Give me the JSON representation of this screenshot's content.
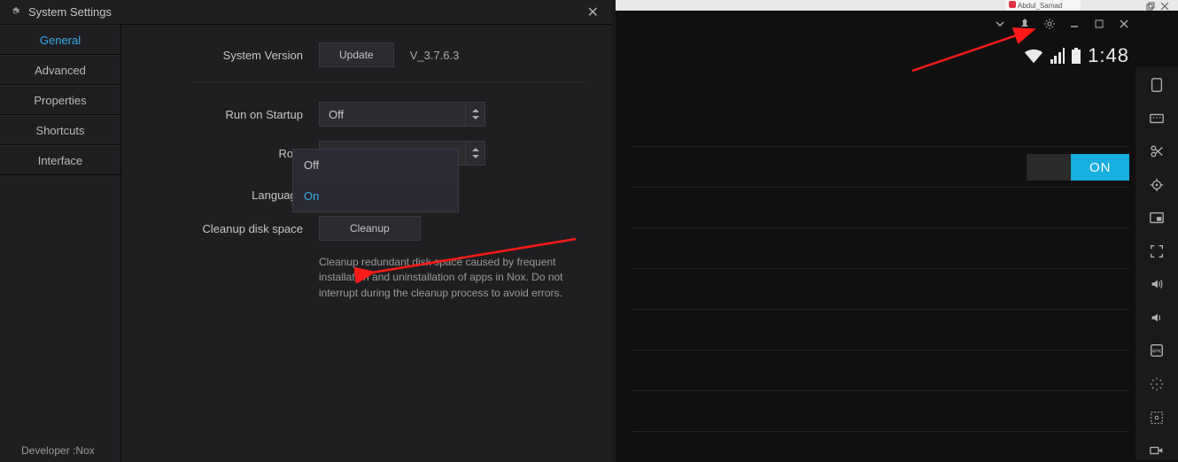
{
  "dialog": {
    "title": "System Settings",
    "tabs": [
      "General",
      "Advanced",
      "Properties",
      "Shortcuts",
      "Interface"
    ],
    "active_tab": "General",
    "general": {
      "system_version_label": "System Version",
      "update_button": "Update",
      "version_text": "V_3.7.6.3",
      "run_on_startup_label": "Run on Startup",
      "run_on_startup_value": "Off",
      "root_label": "Root",
      "root_value": "Off",
      "root_options": [
        "Off",
        "On"
      ],
      "root_selected_option": "On",
      "language_label": "Language",
      "cleanup_label": "Cleanup disk space",
      "cleanup_button": "Cleanup",
      "cleanup_help": "Cleanup redundant disk space caused by frequent installation and uninstallation of apps in Nox. Do not interrupt during the cleanup process to avoid errors."
    },
    "footer": "Developer :Nox"
  },
  "browser": {
    "tab_name": "Abdul_Samad"
  },
  "android": {
    "clock": "1:48",
    "toggle_label": "ON"
  },
  "toolbar_icons": [
    "chevron-down",
    "pin",
    "gear",
    "minimize",
    "maximize",
    "close"
  ],
  "sidebar_icons": [
    "rotate",
    "keyboard",
    "scissors",
    "location",
    "pip",
    "fullscreen",
    "volume-up",
    "volume-down",
    "apk",
    "shake",
    "screenshot",
    "record"
  ]
}
